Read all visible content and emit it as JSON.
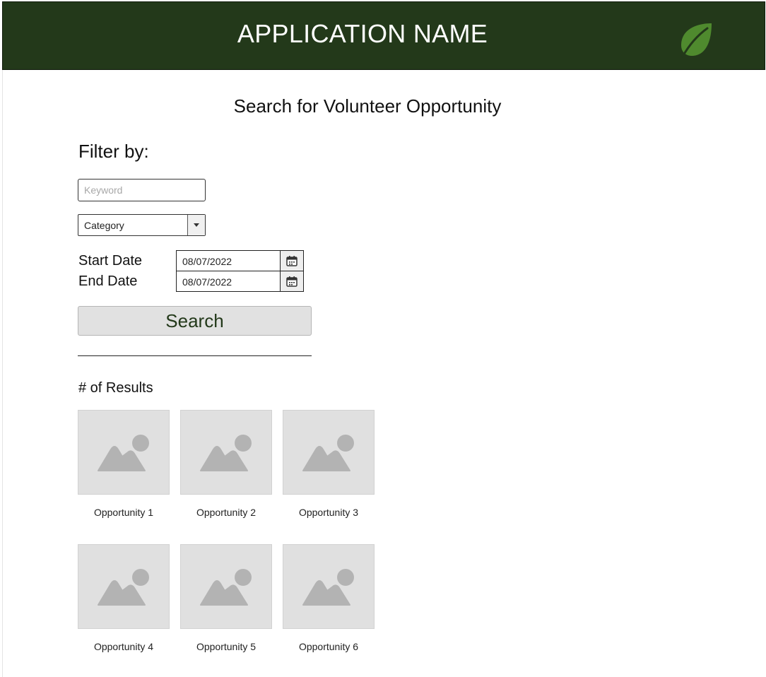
{
  "app": {
    "title": "APPLICATION NAME",
    "logo_icon": "leaf-icon",
    "brand_color": "#23391a"
  },
  "page": {
    "heading": "Search for Volunteer Opportunity"
  },
  "filters": {
    "label": "Filter by:",
    "keyword": {
      "placeholder": "Keyword",
      "value": ""
    },
    "category": {
      "selected": "Category",
      "icon": "chevron-down-icon"
    },
    "start_date": {
      "label": "Start Date",
      "value": "08/07/2022",
      "icon": "calendar-icon"
    },
    "end_date": {
      "label": "End Date",
      "value": "08/07/2022",
      "icon": "calendar-icon"
    },
    "search_button": "Search"
  },
  "results": {
    "count_label": "# of Results",
    "items": [
      {
        "label": "Opportunity 1",
        "icon": "image-placeholder-icon"
      },
      {
        "label": "Opportunity 2",
        "icon": "image-placeholder-icon"
      },
      {
        "label": "Opportunity 3",
        "icon": "image-placeholder-icon"
      },
      {
        "label": "Opportunity 4",
        "icon": "image-placeholder-icon"
      },
      {
        "label": "Opportunity 5",
        "icon": "image-placeholder-icon"
      },
      {
        "label": "Opportunity 6",
        "icon": "image-placeholder-icon"
      }
    ]
  }
}
